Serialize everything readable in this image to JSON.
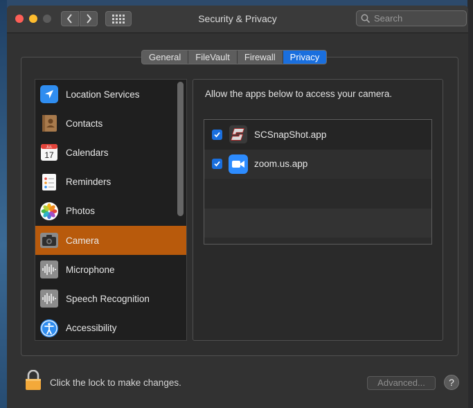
{
  "window": {
    "title": "Security & Privacy",
    "search_placeholder": "Search"
  },
  "tabs": [
    {
      "label": "General",
      "active": false
    },
    {
      "label": "FileVault",
      "active": false
    },
    {
      "label": "Firewall",
      "active": false
    },
    {
      "label": "Privacy",
      "active": true
    }
  ],
  "sidebar": {
    "items": [
      {
        "label": "Location Services",
        "icon": "location-arrow-icon",
        "selected": false
      },
      {
        "label": "Contacts",
        "icon": "contacts-book-icon",
        "selected": false
      },
      {
        "label": "Calendars",
        "icon": "calendar-icon",
        "selected": false
      },
      {
        "label": "Reminders",
        "icon": "reminders-list-icon",
        "selected": false
      },
      {
        "label": "Photos",
        "icon": "photos-flower-icon",
        "selected": false
      },
      {
        "label": "Camera",
        "icon": "camera-icon",
        "selected": true
      },
      {
        "label": "Microphone",
        "icon": "waveform-icon",
        "selected": false
      },
      {
        "label": "Speech Recognition",
        "icon": "waveform-icon",
        "selected": false
      },
      {
        "label": "Accessibility",
        "icon": "accessibility-icon",
        "selected": false
      }
    ],
    "calendar_day": "17",
    "calendar_month": "JUL"
  },
  "panel": {
    "description": "Allow the apps below to access your camera.",
    "apps": [
      {
        "name": "SCSnapShot.app",
        "checked": true,
        "icon": "scsnapshot-app-icon"
      },
      {
        "name": "zoom.us.app",
        "checked": true,
        "icon": "zoom-camera-icon"
      }
    ]
  },
  "footer": {
    "lock_text": "Click the lock to make changes.",
    "advanced_label": "Advanced...",
    "help_label": "?"
  },
  "colors": {
    "accent": "#1a6fde",
    "selection": "#b85a0c"
  }
}
